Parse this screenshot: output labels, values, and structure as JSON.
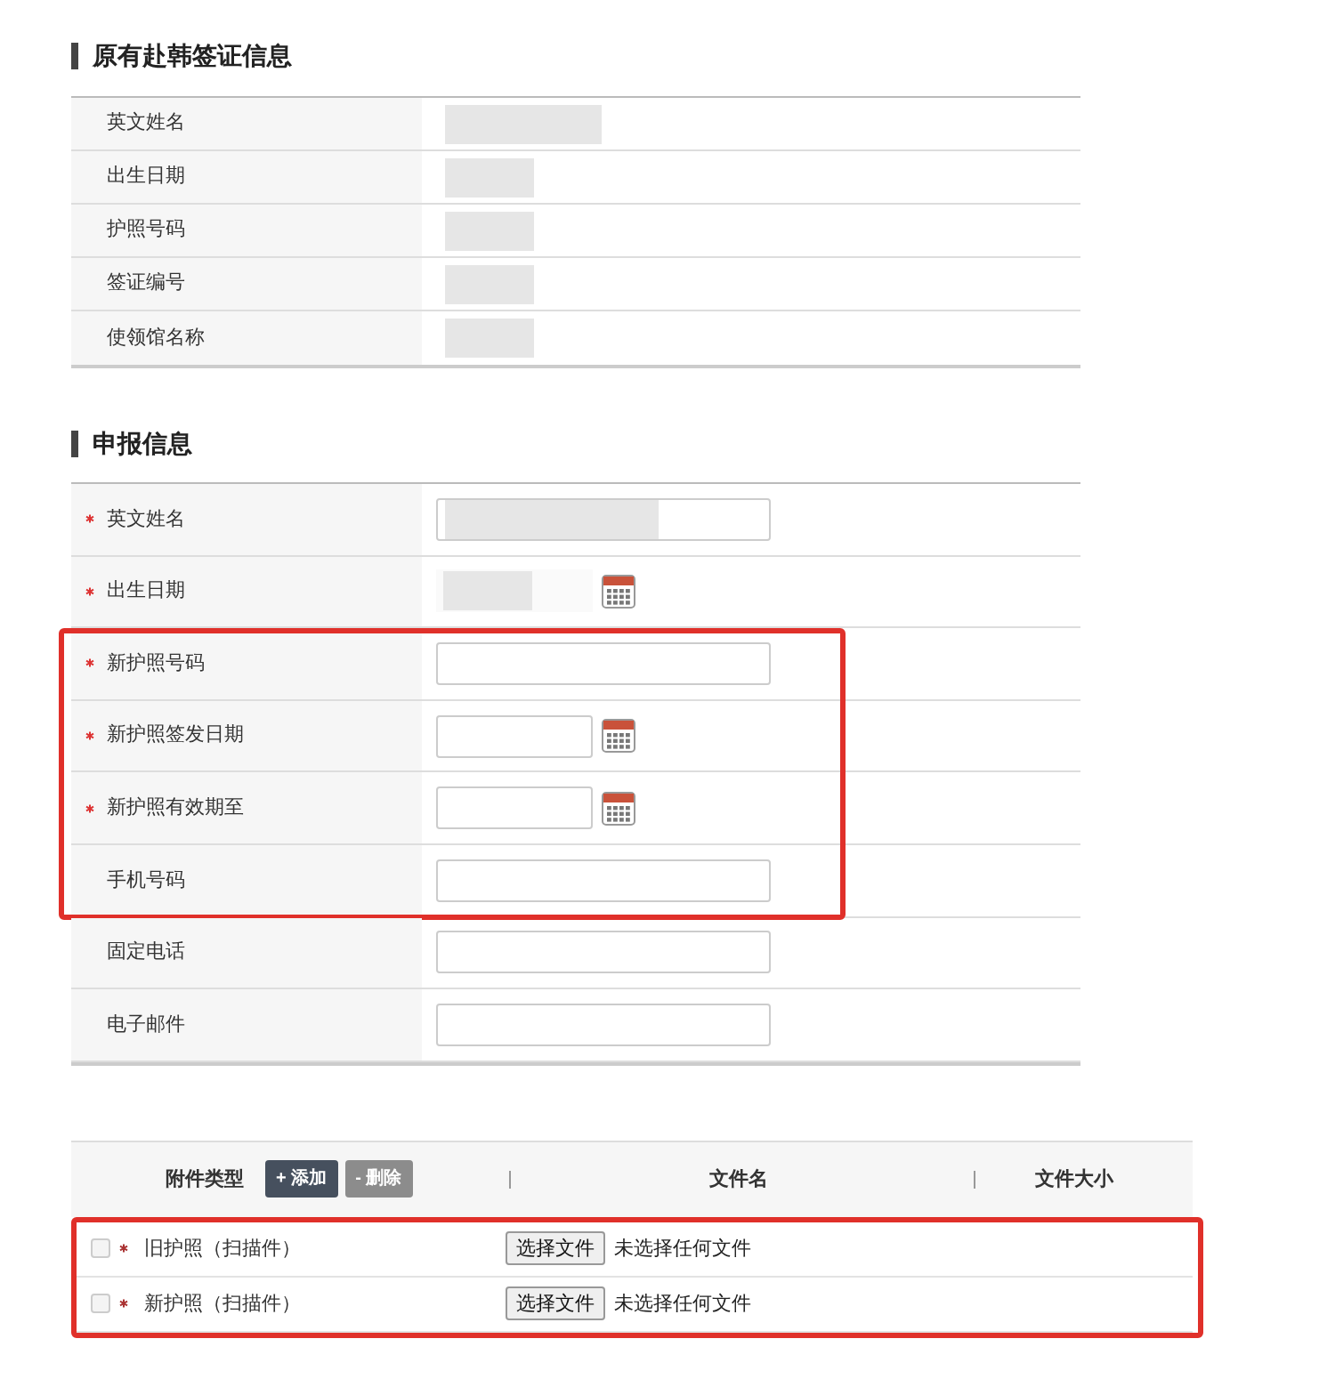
{
  "original_visa": {
    "title": "原有赴韩签证信息",
    "rows": [
      {
        "label": "英文姓名",
        "redacted": true
      },
      {
        "label": "出生日期",
        "redacted": true
      },
      {
        "label": "护照号码",
        "redacted": true
      },
      {
        "label": "签证编号",
        "redacted": true
      },
      {
        "label": "使领馆名称",
        "redacted": true
      }
    ]
  },
  "declaration": {
    "title": "申报信息",
    "rows": [
      {
        "label": "英文姓名",
        "required": true,
        "kind": "text",
        "redacted": true,
        "highlighted": false
      },
      {
        "label": "出生日期",
        "required": true,
        "kind": "date",
        "redacted": true,
        "highlighted": false
      },
      {
        "label": "新护照号码",
        "required": true,
        "kind": "text",
        "redacted": false,
        "highlighted": true
      },
      {
        "label": "新护照签发日期",
        "required": true,
        "kind": "date",
        "redacted": false,
        "highlighted": true
      },
      {
        "label": "新护照有效期至",
        "required": true,
        "kind": "date",
        "redacted": false,
        "highlighted": true
      },
      {
        "label": "手机号码",
        "required": false,
        "kind": "text",
        "redacted": false,
        "highlighted": true
      },
      {
        "label": "固定电话",
        "required": false,
        "kind": "text",
        "redacted": false,
        "highlighted": false
      },
      {
        "label": "电子邮件",
        "required": false,
        "kind": "text",
        "redacted": false,
        "highlighted": false
      }
    ]
  },
  "attachments": {
    "columns": [
      "附件类型",
      "文件名",
      "文件大小"
    ],
    "add_button": "+ 添加",
    "delete_button": "- 删除",
    "highlighted": true,
    "rows": [
      {
        "checked": false,
        "required": true,
        "type": "旧护照（扫描件）",
        "choose_button": "选择文件",
        "file_status": "未选择任何文件"
      },
      {
        "checked": false,
        "required": true,
        "type": "新护照（扫描件）",
        "choose_button": "选择文件",
        "file_status": "未选择任何文件"
      }
    ]
  }
}
